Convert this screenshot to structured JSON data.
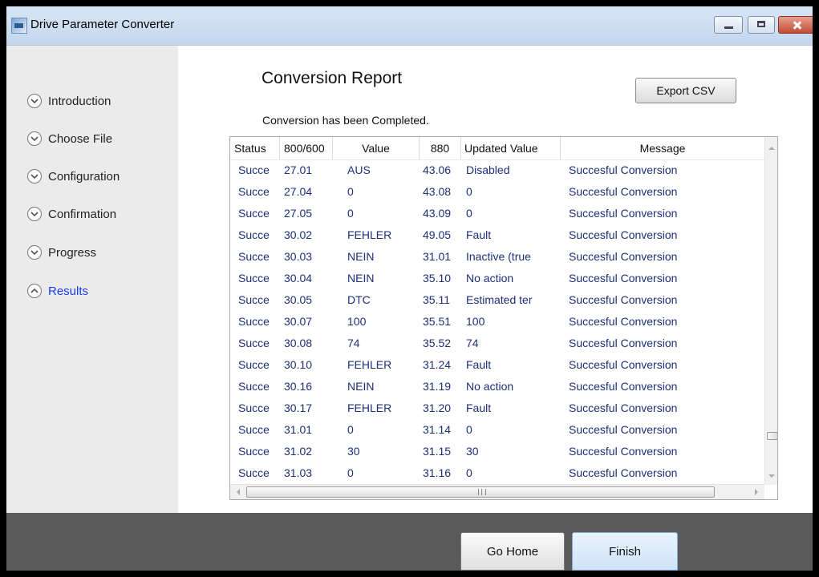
{
  "window": {
    "title": "Drive Parameter Converter"
  },
  "sidebar": {
    "items": [
      {
        "label": "Introduction",
        "state": "collapsed"
      },
      {
        "label": "Choose File",
        "state": "collapsed"
      },
      {
        "label": "Configuration",
        "state": "collapsed"
      },
      {
        "label": "Confirmation",
        "state": "collapsed"
      },
      {
        "label": "Progress",
        "state": "collapsed"
      },
      {
        "label": "Results",
        "state": "active"
      }
    ]
  },
  "report": {
    "title": "Conversion Report",
    "subtitle": "Conversion has been Completed.",
    "export_label": "Export CSV"
  },
  "table": {
    "columns": [
      "Status",
      "800/600",
      "Value",
      "880",
      "Updated Value",
      "Message"
    ],
    "rows": [
      [
        "Succe",
        "27.01",
        "AUS",
        "43.06",
        "Disabled",
        "Succesful Conversion"
      ],
      [
        "Succe",
        "27.04",
        "0",
        "43.08",
        "0",
        "Succesful Conversion"
      ],
      [
        "Succe",
        "27.05",
        "0",
        "43.09",
        "0",
        "Succesful Conversion"
      ],
      [
        "Succe",
        "30.02",
        "FEHLER",
        "49.05",
        "Fault",
        "Succesful Conversion"
      ],
      [
        "Succe",
        "30.03",
        "NEIN",
        "31.01",
        "Inactive (true",
        "Succesful Conversion"
      ],
      [
        "Succe",
        "30.04",
        "NEIN",
        "35.10",
        "No action",
        "Succesful Conversion"
      ],
      [
        "Succe",
        "30.05",
        "DTC",
        "35.11",
        "Estimated ter",
        "Succesful Conversion"
      ],
      [
        "Succe",
        "30.07",
        "100",
        "35.51",
        "100",
        "Succesful Conversion"
      ],
      [
        "Succe",
        "30.08",
        "74",
        "35.52",
        "74",
        "Succesful Conversion"
      ],
      [
        "Succe",
        "30.10",
        "FEHLER",
        "31.24",
        "Fault",
        "Succesful Conversion"
      ],
      [
        "Succe",
        "30.16",
        "NEIN",
        "31.19",
        "No action",
        "Succesful Conversion"
      ],
      [
        "Succe",
        "30.17",
        "FEHLER",
        "31.20",
        "Fault",
        "Succesful Conversion"
      ],
      [
        "Succe",
        "31.01",
        "0",
        "31.14",
        "0",
        "Succesful Conversion"
      ],
      [
        "Succe",
        "31.02",
        "30",
        "31.15",
        "30",
        "Succesful Conversion"
      ],
      [
        "Succe",
        "31.03",
        "0",
        "31.16",
        "0",
        "Succesful Conversion"
      ]
    ]
  },
  "footer": {
    "home_label": "Go Home",
    "finish_label": "Finish"
  },
  "colors": {
    "active_nav": "#1a3ef0",
    "cell_text": "#1c2f78",
    "footer_bg": "#5a5a5a",
    "finish_bg": "#cfe3f8"
  }
}
